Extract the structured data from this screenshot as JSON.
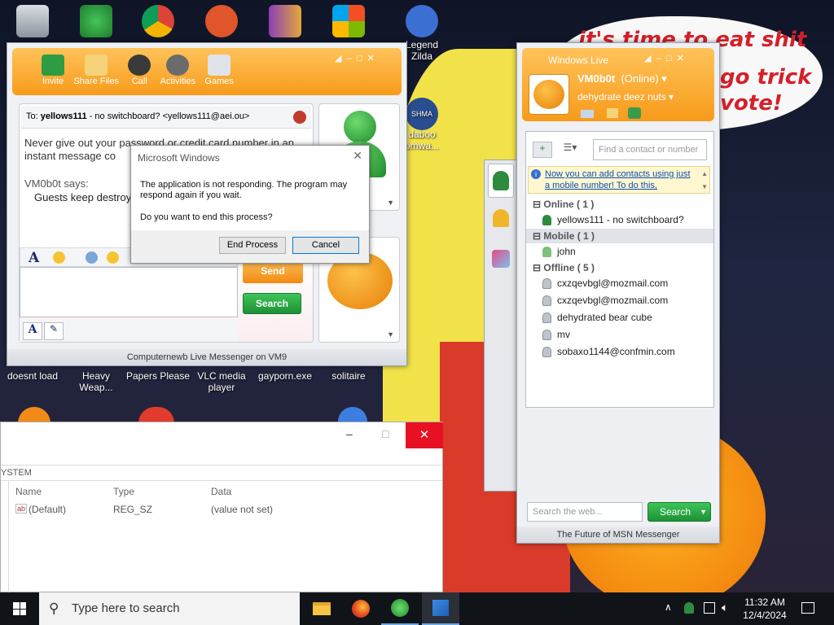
{
  "desktop": {
    "wall_text": [
      "it's time to eat shit",
      "go trick",
      "vote!"
    ],
    "icons_row2": [
      "doesnt load",
      "Heavy\nWeap...",
      "Papers Please",
      "VLC media\nplayer",
      "gayporn.exe",
      "solitaire"
    ],
    "icon_zelda": "Legend\nZilda",
    "icon_daboo": "daboo\nomwa...",
    "icon_shma": "SHMA"
  },
  "messenger": {
    "toolbar": [
      "Invite",
      "Share Files",
      "Call",
      "Activities",
      "Games"
    ],
    "to_label": "To:",
    "to_name": "yellows111",
    "to_detail": "- no switchboard? <yellows111@aei.ou>",
    "warning": "Never give out your password or credit card number in an instant message co",
    "sender": "VM0b0t says:",
    "message": "Guests keep destroy",
    "send": "Send",
    "search": "Search",
    "footer": "Computernewb Live Messenger on VM9"
  },
  "dialog": {
    "title": "Microsoft Windows",
    "line1": "The application is not responding. The program may respond again if you wait.",
    "line2": "Do you want to end this process?",
    "end": "End Process",
    "cancel": "Cancel"
  },
  "contacts": {
    "title": "Windows Live",
    "name": "VM0b0t",
    "status": "(Online)",
    "psm": "dehydrate deez nuts",
    "find_placeholder": "Find a contact or number",
    "banner": "Now you can add contacts using just a mobile number! To do this,",
    "groups": [
      {
        "label": "Online ( 1 )",
        "items": [
          {
            "name": "yellows111 - no switchboard?",
            "state": "on"
          }
        ]
      },
      {
        "label": "Mobile ( 1 )",
        "items": [
          {
            "name": "john",
            "state": "mob"
          }
        ]
      },
      {
        "label": "Offline ( 5 )",
        "items": [
          {
            "name": "cxzqevbgl@mozmail.com",
            "state": "off"
          },
          {
            "name": "cxzqevbgl@mozmail.com",
            "state": "off"
          },
          {
            "name": "dehydrated bear cube",
            "state": "off"
          },
          {
            "name": "mv",
            "state": "off"
          },
          {
            "name": "sobaxo1144@confmin.com",
            "state": "off"
          }
        ]
      }
    ],
    "search_placeholder": "Search the web...",
    "search": "Search",
    "footer": "The Future of MSN Messenger"
  },
  "regedit": {
    "path": "YSTEM",
    "columns": [
      "Name",
      "Type",
      "Data"
    ],
    "row": [
      "(Default)",
      "REG_SZ",
      "(value not set)"
    ],
    "icon": "ab"
  },
  "taskbar": {
    "search": "Type here to search",
    "time": "11:32 AM",
    "date": "12/4/2024"
  }
}
